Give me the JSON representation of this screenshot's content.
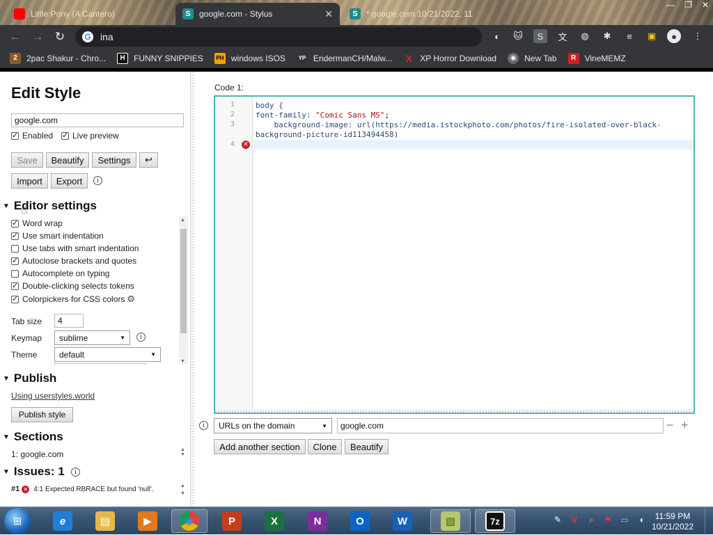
{
  "browser": {
    "tabs": [
      {
        "title": "Little Pony (A Cantero)",
        "favicon_color": "#ff0000"
      },
      {
        "title": "google.com - Stylus",
        "favicon_color": "#1e8c8c"
      },
      {
        "title": "* google.com 10/21/2022, 11",
        "favicon_color": "#1e8c8c"
      }
    ],
    "window_controls": [
      "—",
      "❐",
      "✕"
    ],
    "omnibox_text": "ina",
    "nav_icons": [
      "←",
      "→",
      "↻"
    ],
    "bookmarks": [
      {
        "label": "2pac Shakur - Chro...",
        "icon_text": "2",
        "icon_color": "#8b5a2b"
      },
      {
        "label": "FUNNY SNIPPIES",
        "icon_text": "H",
        "icon_color": "#111111"
      },
      {
        "label": "windows ISOS",
        "icon_text": "PH",
        "icon_color": "#f4a000"
      },
      {
        "label": "EndermanCH/Malw...",
        "icon_text": "YP",
        "icon_color": "#333333"
      },
      {
        "label": "XP Horror Download",
        "icon_text": "X",
        "icon_color": "#35363a"
      },
      {
        "label": "New Tab",
        "icon_text": "◉",
        "icon_color": "#6b6b6b"
      },
      {
        "label": "VineMEMZ",
        "icon_text": "R",
        "icon_color": "#cc2222"
      }
    ]
  },
  "stylus": {
    "heading": "Edit Style",
    "style_name": "google.com",
    "enabled_label": "Enabled",
    "live_preview_label": "Live preview",
    "buttons": {
      "save": "Save",
      "beautify": "Beautify",
      "settings": "Settings",
      "undo": "↩",
      "import": "Import",
      "export": "Export"
    },
    "editor_settings": {
      "title": "Editor settings",
      "options": [
        {
          "label": "Word wrap",
          "checked": true
        },
        {
          "label": "Use smart indentation",
          "checked": true
        },
        {
          "label": "Use tabs with smart indentation",
          "checked": false
        },
        {
          "label": "Autoclose brackets and quotes",
          "checked": true
        },
        {
          "label": "Autocomplete on typing",
          "checked": false
        },
        {
          "label": "Double-clicking selects tokens",
          "checked": true
        },
        {
          "label": "Colorpickers for CSS colors",
          "checked": true
        }
      ],
      "tab_size_label": "Tab size",
      "tab_size": "4",
      "keymap_label": "Keymap",
      "keymap": "sublime",
      "theme_label": "Theme",
      "theme": "default"
    },
    "publish": {
      "title": "Publish",
      "link": "Using userstyles.world",
      "button": "Publish style"
    },
    "sections": {
      "title": "Sections",
      "item": "1: google.com"
    },
    "issues": {
      "title": "Issues: 1",
      "item_num": "#1",
      "item_text": "4:1  Expected RBRACE but found 'null'."
    }
  },
  "editor": {
    "label": "Code 1:",
    "lines": [
      {
        "num": "1",
        "text": "body {"
      },
      {
        "num": "2",
        "prop": "font-family: ",
        "value": "\"Comic Sans MS\"",
        "tail": ";"
      },
      {
        "num": "3",
        "prop": "    background-image: url(",
        "value": "https://media.istockphoto.com/photos/fire-isolated-over-black-",
        "tail": ""
      },
      {
        "num": "",
        "prop": "",
        "value": "background-picture-id113494458",
        "tail": ")"
      },
      {
        "num": "4",
        "text": ""
      }
    ],
    "applies_to": "URLs on the domain",
    "domain_value": "google.com",
    "minus": "−",
    "plus": "+",
    "add_section": "Add another section",
    "clone": "Clone",
    "beautify": "Beautify"
  },
  "taskbar": {
    "time": "11:59 PM",
    "date": "10/21/2022",
    "apps": [
      {
        "name": "ie",
        "label": "e",
        "color": "#1e7fd6"
      },
      {
        "name": "explorer",
        "label": "▤",
        "color": "#e6b84a"
      },
      {
        "name": "media",
        "label": "▶",
        "color": "#e07a1f"
      },
      {
        "name": "chrome",
        "label": "◉",
        "color": "#db4437"
      },
      {
        "name": "powerpoint",
        "label": "P",
        "color": "#c43e1c"
      },
      {
        "name": "excel",
        "label": "X",
        "color": "#1d7044"
      },
      {
        "name": "onenote",
        "label": "N",
        "color": "#7b2f9c"
      },
      {
        "name": "outlook",
        "label": "O",
        "color": "#0a64c2"
      },
      {
        "name": "word",
        "label": "W",
        "color": "#1c5eb8"
      },
      {
        "name": "notes",
        "label": "▧",
        "color": "#b6c86a"
      },
      {
        "name": "7zip",
        "label": "7z",
        "color": "#111111"
      }
    ]
  }
}
